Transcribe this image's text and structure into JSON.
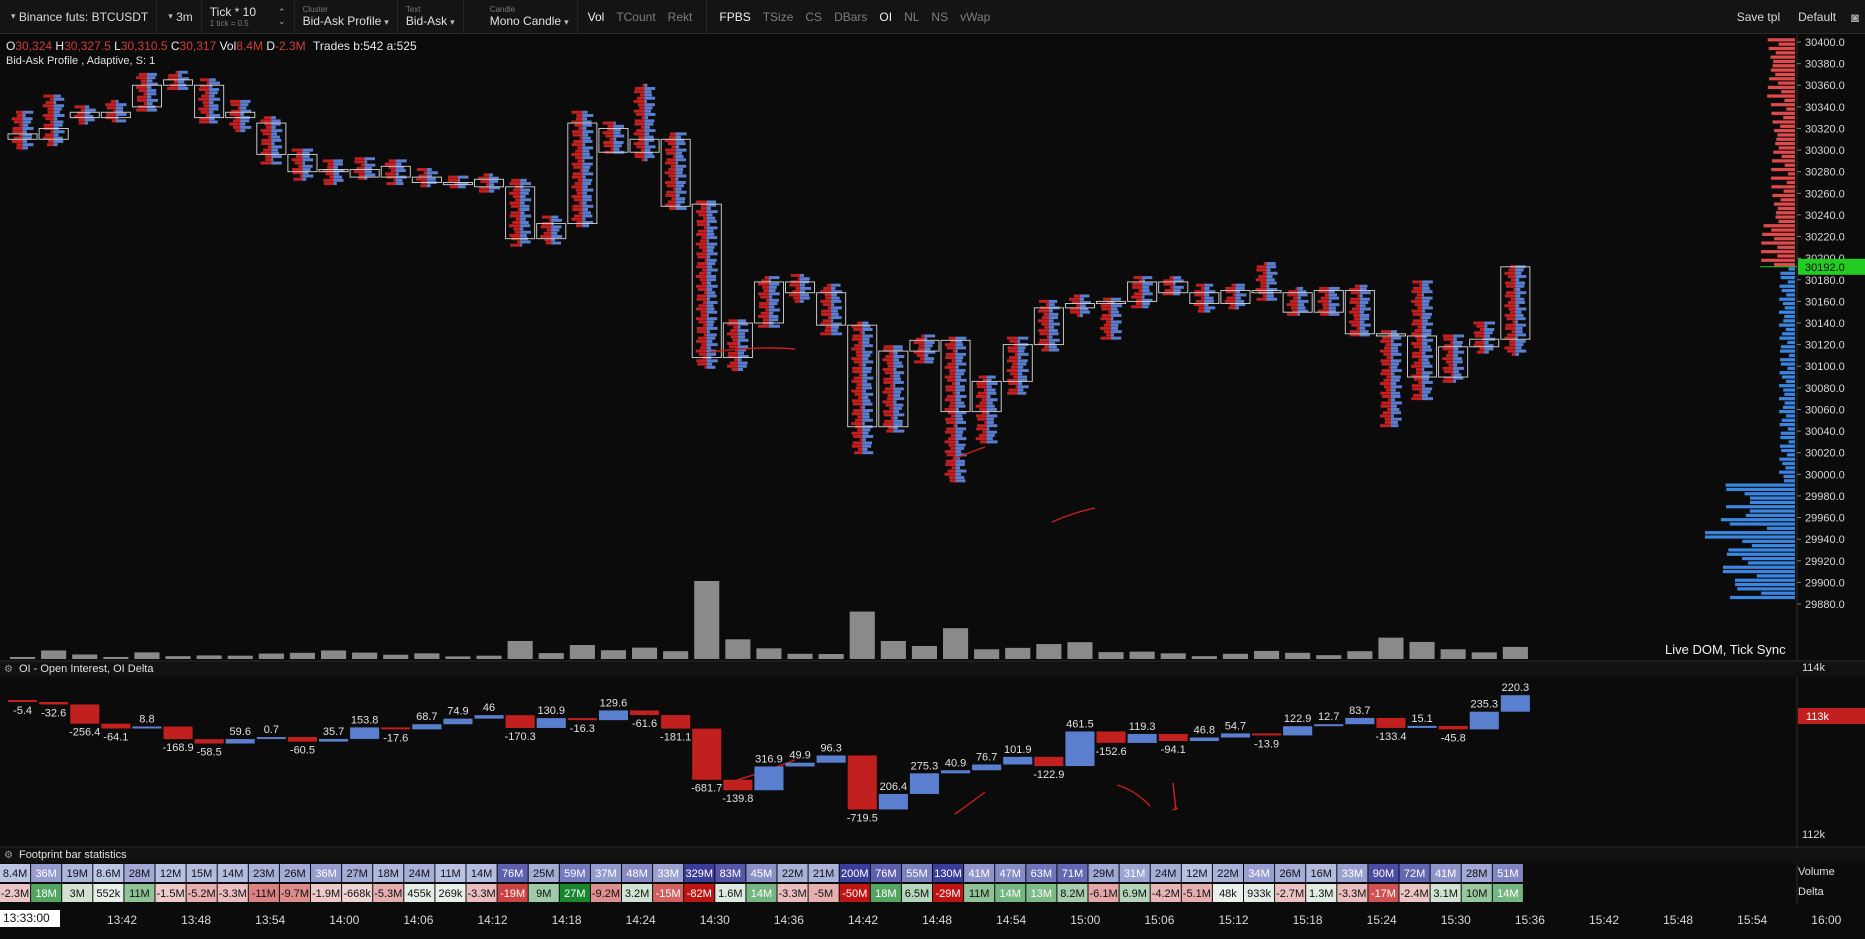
{
  "toolbar": {
    "symbol": "Binance futs: BTCUSDT",
    "timeframe": "3m",
    "tick_main": "Tick * 10",
    "tick_sub": "1 tick = 0.5",
    "cluster_label": "Cluster",
    "cluster_value": "Bid-Ask Profile",
    "text_label": "Text",
    "text_value": "Bid-Ask",
    "candle_label": "Candle",
    "candle_value": "Mono Candle",
    "toggles": [
      {
        "label": "Vol",
        "on": true
      },
      {
        "label": "TCount",
        "on": false
      },
      {
        "label": "Rekt",
        "on": false
      },
      {
        "label": "FPBS",
        "on": true
      },
      {
        "label": "TSize",
        "on": false
      },
      {
        "label": "CS",
        "on": false
      },
      {
        "label": "DBars",
        "on": false
      },
      {
        "label": "OI",
        "on": true
      },
      {
        "label": "NL",
        "on": false
      },
      {
        "label": "NS",
        "on": false
      },
      {
        "label": "vWap",
        "on": false
      }
    ],
    "save_tpl": "Save tpl",
    "default_tpl": "Default"
  },
  "ohlc": {
    "o_key": "O",
    "o": "30,324",
    "h_key": "H",
    "h": "30,327.5",
    "l_key": "L",
    "l": "30,310.5",
    "c_key": "C",
    "c": "30,317",
    "vol_key": "Vol",
    "vol": "8.4M",
    "d_key": "D",
    "d": "-2.3M",
    "trades": "Trades b:542 a:525"
  },
  "study_title": "Bid-Ask Profile , Adaptive, S: 1",
  "live_dom": "Live DOM, Tick Sync",
  "price_axis": {
    "labels": [
      "30400.0",
      "30380.0",
      "30360.0",
      "30340.0",
      "30320.0",
      "30300.0",
      "30280.0",
      "30260.0",
      "30240.0",
      "30220.0",
      "30200.0",
      "30180.0",
      "30160.0",
      "30140.0",
      "30120.0",
      "30100.0",
      "30080.0",
      "30060.0",
      "30040.0",
      "30020.0",
      "30000.0",
      "29980.0",
      "29960.0",
      "29940.0",
      "29920.0",
      "29900.0",
      "29880.0"
    ],
    "current": "30192.0",
    "current_color": "#22cc22"
  },
  "oi_pane": {
    "title": "OI - Open Interest, OI Delta",
    "axis_top": "114k",
    "axis_current": "113k",
    "axis_bottom": "112k",
    "deltas": [
      -5.4,
      -32.6,
      -256.4,
      -64.1,
      8.8,
      -168.9,
      -58.5,
      59.6,
      0.7,
      -60.5,
      35.7,
      153.8,
      -17.6,
      68.7,
      74.9,
      46,
      -170.3,
      130.9,
      -16.3,
      129.6,
      -61.6,
      -181.1,
      -681.7,
      -139.8,
      316.9,
      49.9,
      96.3,
      -719.5,
      206.4,
      275.3,
      40.9,
      76.7,
      101.9,
      -122.9,
      461.5,
      -152.6,
      119.3,
      -94.1,
      46.8,
      54.7,
      -13.9,
      122.9,
      12.7,
      83.7,
      -133.4,
      15.1,
      -45.8,
      235.3,
      220.3
    ]
  },
  "stats_pane": {
    "title": "Footprint bar statistics",
    "volume_label": "Volume",
    "delta_label": "Delta",
    "volume": [
      "8.4M",
      "36M",
      "19M",
      "8.6M",
      "28M",
      "12M",
      "15M",
      "14M",
      "23M",
      "26M",
      "36M",
      "27M",
      "18M",
      "24M",
      "11M",
      "14M",
      "76M",
      "25M",
      "59M",
      "37M",
      "48M",
      "33M",
      "329M",
      "83M",
      "45M",
      "22M",
      "21M",
      "200M",
      "76M",
      "55M",
      "130M",
      "41M",
      "47M",
      "63M",
      "71M",
      "29M",
      "31M",
      "24M",
      "12M",
      "22M",
      "34M",
      "26M",
      "16M",
      "33M",
      "90M",
      "72M",
      "41M",
      "28M",
      "51M"
    ],
    "delta": [
      "-2.3M",
      "18M",
      "3M",
      "552k",
      "11M",
      "-1.5M",
      "-5.2M",
      "-3.3M",
      "-11M",
      "-9.7M",
      "-1.9M",
      "-668k",
      "-5.3M",
      "455k",
      "269k",
      "-3.3M",
      "-19M",
      "9M",
      "27M",
      "-9.2M",
      "3.2M",
      "-15M",
      "-82M",
      "1.6M",
      "14M",
      "-3.3M",
      "-5M",
      "-50M",
      "18M",
      "6.5M",
      "-29M",
      "11M",
      "14M",
      "13M",
      "8.2M",
      "-6.1M",
      "6.9M",
      "-4.2M",
      "-5.1M",
      "48k",
      "933k",
      "-2.7M",
      "1.3M",
      "-3.3M",
      "-17M",
      "-2.4M",
      "3.1M",
      "10M",
      "14M"
    ]
  },
  "time_axis": {
    "cursor": "13:33:00",
    "labels": [
      "13:42",
      "13:48",
      "13:54",
      "14:00",
      "14:06",
      "14:12",
      "14:18",
      "14:24",
      "14:30",
      "14:36",
      "14:42",
      "14:48",
      "14:54",
      "15:00",
      "15:06",
      "15:12",
      "15:18",
      "15:24",
      "15:30",
      "15:36",
      "15:42",
      "15:48",
      "15:54",
      "16:00"
    ]
  },
  "chart_data": {
    "type": "candlestick-footprint",
    "title": "Bid-Ask Profile , Adaptive, S: 1",
    "y_range": [
      29870,
      30410
    ],
    "bars": [
      {
        "o": 30315,
        "h": 30335,
        "l": 30300,
        "c": 30310,
        "v": 8.4
      },
      {
        "o": 30310,
        "h": 30350,
        "l": 30305,
        "c": 30320,
        "v": 36
      },
      {
        "o": 30335,
        "h": 30340,
        "l": 30325,
        "c": 30330,
        "v": 19
      },
      {
        "o": 30330,
        "h": 30345,
        "l": 30325,
        "c": 30335,
        "v": 8.6
      },
      {
        "o": 30340,
        "h": 30370,
        "l": 30335,
        "c": 30360,
        "v": 28
      },
      {
        "o": 30365,
        "h": 30372,
        "l": 30355,
        "c": 30360,
        "v": 12
      },
      {
        "o": 30360,
        "h": 30365,
        "l": 30325,
        "c": 30330,
        "v": 15
      },
      {
        "o": 30330,
        "h": 30345,
        "l": 30318,
        "c": 30335,
        "v": 14
      },
      {
        "o": 30325,
        "h": 30330,
        "l": 30288,
        "c": 30296,
        "v": 23
      },
      {
        "o": 30296,
        "h": 30300,
        "l": 30272,
        "c": 30280,
        "v": 26
      },
      {
        "o": 30280,
        "h": 30290,
        "l": 30268,
        "c": 30282,
        "v": 36
      },
      {
        "o": 30282,
        "h": 30292,
        "l": 30272,
        "c": 30275,
        "v": 27
      },
      {
        "o": 30275,
        "h": 30290,
        "l": 30268,
        "c": 30285,
        "v": 18
      },
      {
        "o": 30275,
        "h": 30282,
        "l": 30265,
        "c": 30270,
        "v": 24
      },
      {
        "o": 30270,
        "h": 30275,
        "l": 30264,
        "c": 30268,
        "v": 11
      },
      {
        "o": 30273,
        "h": 30277,
        "l": 30262,
        "c": 30266,
        "v": 14
      },
      {
        "o": 30266,
        "h": 30272,
        "l": 30212,
        "c": 30218,
        "v": 76
      },
      {
        "o": 30218,
        "h": 30238,
        "l": 30212,
        "c": 30232,
        "v": 25
      },
      {
        "o": 30232,
        "h": 30335,
        "l": 30230,
        "c": 30325,
        "v": 59
      },
      {
        "o": 30320,
        "h": 30325,
        "l": 30296,
        "c": 30298,
        "v": 37
      },
      {
        "o": 30298,
        "h": 30360,
        "l": 30290,
        "c": 30310,
        "v": 48
      },
      {
        "o": 30310,
        "h": 30315,
        "l": 30245,
        "c": 30248,
        "v": 33
      },
      {
        "o": 30250,
        "h": 30252,
        "l": 30098,
        "c": 30108,
        "v": 329
      },
      {
        "o": 30108,
        "h": 30142,
        "l": 30096,
        "c": 30140,
        "v": 83
      },
      {
        "o": 30140,
        "h": 30182,
        "l": 30135,
        "c": 30178,
        "v": 45
      },
      {
        "o": 30178,
        "h": 30184,
        "l": 30160,
        "c": 30168,
        "v": 22
      },
      {
        "o": 30168,
        "h": 30175,
        "l": 30130,
        "c": 30138,
        "v": 21
      },
      {
        "o": 30138,
        "h": 30140,
        "l": 30020,
        "c": 30044,
        "v": 200
      },
      {
        "o": 30044,
        "h": 30118,
        "l": 30040,
        "c": 30114,
        "v": 76
      },
      {
        "o": 30114,
        "h": 30128,
        "l": 30102,
        "c": 30124,
        "v": 55
      },
      {
        "o": 30124,
        "h": 30126,
        "l": 29992,
        "c": 30058,
        "v": 130
      },
      {
        "o": 30058,
        "h": 30090,
        "l": 30030,
        "c": 30086,
        "v": 41
      },
      {
        "o": 30086,
        "h": 30126,
        "l": 30075,
        "c": 30120,
        "v": 47
      },
      {
        "o": 30120,
        "h": 30160,
        "l": 30115,
        "c": 30154,
        "v": 63
      },
      {
        "o": 30154,
        "h": 30165,
        "l": 30145,
        "c": 30158,
        "v": 71
      },
      {
        "o": 30158,
        "h": 30162,
        "l": 30125,
        "c": 30160,
        "v": 29
      },
      {
        "o": 30160,
        "h": 30182,
        "l": 30155,
        "c": 30178,
        "v": 31
      },
      {
        "o": 30178,
        "h": 30182,
        "l": 30165,
        "c": 30168,
        "v": 24
      },
      {
        "o": 30168,
        "h": 30175,
        "l": 30150,
        "c": 30158,
        "v": 12
      },
      {
        "o": 30158,
        "h": 30175,
        "l": 30152,
        "c": 30170,
        "v": 22
      },
      {
        "o": 30170,
        "h": 30195,
        "l": 30160,
        "c": 30168,
        "v": 34
      },
      {
        "o": 30168,
        "h": 30172,
        "l": 30148,
        "c": 30150,
        "v": 26
      },
      {
        "o": 30150,
        "h": 30172,
        "l": 30148,
        "c": 30170,
        "v": 16
      },
      {
        "o": 30170,
        "h": 30174,
        "l": 30128,
        "c": 30130,
        "v": 33
      },
      {
        "o": 30130,
        "h": 30132,
        "l": 30045,
        "c": 30128,
        "v": 90
      },
      {
        "o": 30128,
        "h": 30178,
        "l": 30070,
        "c": 30090,
        "v": 72
      },
      {
        "o": 30090,
        "h": 30128,
        "l": 30085,
        "c": 30118,
        "v": 41
      },
      {
        "o": 30118,
        "h": 30140,
        "l": 30112,
        "c": 30125,
        "v": 28
      },
      {
        "o": 30125,
        "h": 30192,
        "l": 30110,
        "c": 30192,
        "v": 51
      }
    ]
  }
}
